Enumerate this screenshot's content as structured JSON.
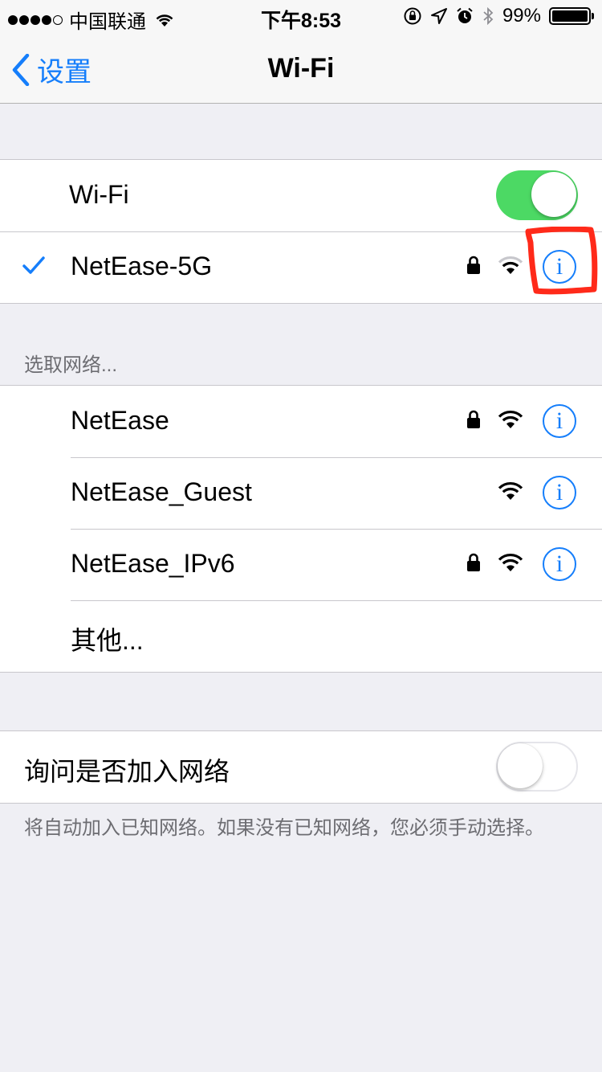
{
  "status_bar": {
    "carrier": "中国联通",
    "time": "下午8:53",
    "battery_percent": "99%",
    "battery_level": 0.99,
    "signal_bars_filled": 4,
    "signal_bars_total": 5
  },
  "nav": {
    "back_label": "设置",
    "title": "Wi-Fi"
  },
  "wifi_section": {
    "toggle_label": "Wi-Fi",
    "toggle_on": true,
    "connected_network": "NetEase-5G"
  },
  "networks_section": {
    "header": "选取网络...",
    "networks": [
      {
        "name": "NetEase",
        "locked": true
      },
      {
        "name": "NetEase_Guest",
        "locked": false
      },
      {
        "name": "NetEase_IPv6",
        "locked": true
      }
    ],
    "other_label": "其他..."
  },
  "ask_section": {
    "label": "询问是否加入网络",
    "toggle_on": false,
    "footer": "将自动加入已知网络。如果没有已知网络，您必须手动选择。"
  },
  "info_glyph": "i",
  "colors": {
    "accent": "#157efb",
    "toggle_on": "#4cd964",
    "background": "#efeff4",
    "annotation": "#ff2a1a"
  }
}
